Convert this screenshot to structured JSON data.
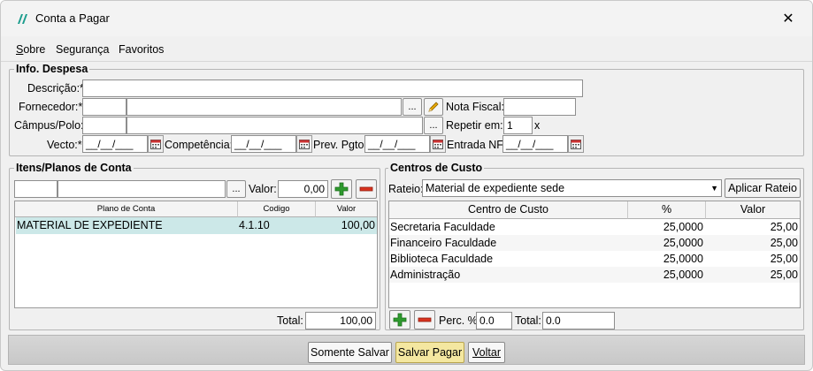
{
  "window": {
    "title": "Conta a Pagar"
  },
  "menu": {
    "items": [
      "Sobre",
      "Segurança",
      "Favoritos"
    ]
  },
  "info_despesa": {
    "legend": "Info. Despesa",
    "descricao": {
      "label": "Descrição:*",
      "value": ""
    },
    "fornecedor": {
      "label": "Fornecedor:*",
      "code": "",
      "name": "",
      "lookup": "..."
    },
    "nota_fiscal": {
      "label": "Nota Fiscal:",
      "value": ""
    },
    "campus": {
      "label": "Câmpus/Polo:",
      "code": "",
      "name": "",
      "lookup": "..."
    },
    "repetir": {
      "label": "Repetir em:",
      "value": "1",
      "suffix": "x"
    },
    "vecto": {
      "label": "Vecto:*",
      "value": "__/__/___"
    },
    "competencia": {
      "label": "Competência:",
      "value": "__/__/___"
    },
    "prev_pgto": {
      "label": "Prev. Pgto.",
      "value": "__/__/___"
    },
    "entrada_nf": {
      "label": "Entrada NF:",
      "value": "__/__/___"
    }
  },
  "itens": {
    "legend": "Itens/Planos de Conta",
    "lookup": "...",
    "valor_label": "Valor:",
    "valor_value": "0,00",
    "columns": [
      "Plano de Conta",
      "Codigo",
      "Valor"
    ],
    "rows": [
      {
        "plano": "MATERIAL DE EXPEDIENTE",
        "codigo": "4.1.10",
        "valor": "100,00"
      }
    ],
    "total_label": "Total:",
    "total_value": "100,00"
  },
  "centros": {
    "legend": "Centros de Custo",
    "rateio_label": "Rateio:",
    "rateio_value": "Material de expediente sede",
    "aplicar_label": "Aplicar Rateio",
    "columns": [
      "Centro de Custo",
      "%",
      "Valor"
    ],
    "rows": [
      {
        "centro": "Secretaria Faculdade",
        "perc": "25,0000",
        "valor": "25,00"
      },
      {
        "centro": "Financeiro Faculdade",
        "perc": "25,0000",
        "valor": "25,00"
      },
      {
        "centro": "Biblioteca Faculdade",
        "perc": "25,0000",
        "valor": "25,00"
      },
      {
        "centro": "Administração",
        "perc": "25,0000",
        "valor": "25,00"
      }
    ],
    "perc_label": "Perc. %:",
    "perc_value": "0.0",
    "total_label": "Total:",
    "total_value": "0.0"
  },
  "footer": {
    "somente_salvar": "Somente Salvar",
    "salvar_pagar": "Salvar Pagar",
    "voltar": "Voltar"
  },
  "colors": {
    "selected_row": "#cce8e8",
    "primary_button": "#f4e7a0",
    "plus": "#2e9a2e",
    "minus": "#d9331f"
  }
}
